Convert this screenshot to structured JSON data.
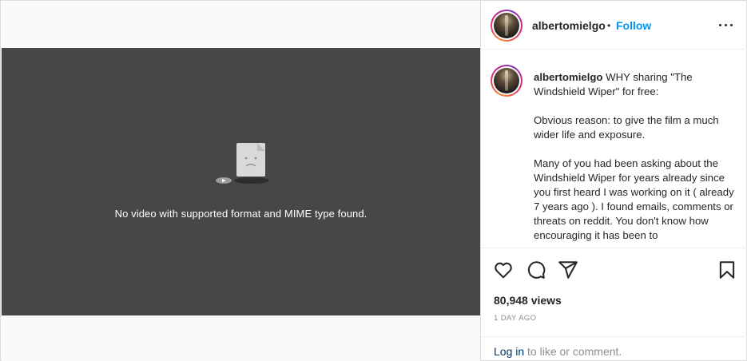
{
  "video": {
    "error_message": "No video with supported format and MIME type found."
  },
  "header": {
    "username": "albertomielgo",
    "separator": "•",
    "follow_label": "Follow",
    "more_icon": "more-horizontal-icon"
  },
  "caption": {
    "username": "albertomielgo",
    "paragraphs": [
      "WHY sharing \"The Windshield Wiper\" for free:",
      "Obvious reason: to give the film a much wider life and exposure.",
      "Many of you had been asking about the Windshield Wiper for years already since you first heard I was working on it ( already 7 years ago ). I found emails, comments or threats on reddit. You don't know how encouraging it has been to"
    ]
  },
  "actions": {
    "like_icon": "heart-icon",
    "comment_icon": "comment-icon",
    "share_icon": "share-icon",
    "save_icon": "bookmark-icon"
  },
  "stats": {
    "views": "80,948 views",
    "posted": "1 DAY AGO"
  },
  "footer": {
    "login_link": "Log in",
    "login_suffix": " to like or comment."
  },
  "colors": {
    "accent": "#0095f6",
    "video_bg": "#474747",
    "link_dark": "#00376b"
  }
}
